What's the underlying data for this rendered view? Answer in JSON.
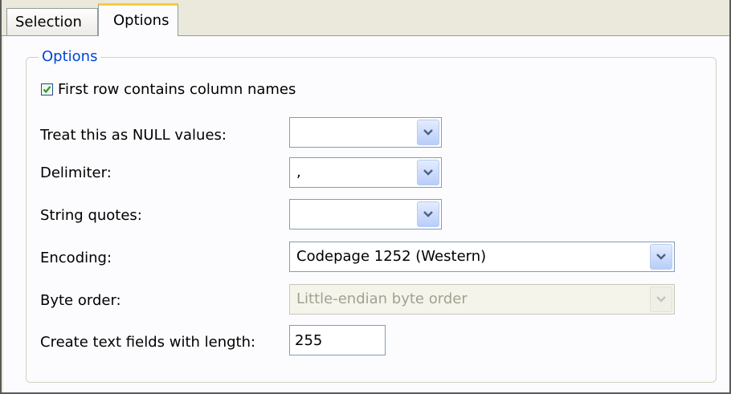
{
  "tabs": [
    {
      "label": "Selection"
    },
    {
      "label": "Options"
    }
  ],
  "group": {
    "title": "Options"
  },
  "first_row_checkbox": {
    "label": "First row contains column names",
    "checked": true
  },
  "fields": {
    "null_values": {
      "label": "Treat this as NULL values:",
      "value": ""
    },
    "delimiter": {
      "label": "Delimiter:",
      "value": ","
    },
    "string_quotes": {
      "label": "String quotes:",
      "value": ""
    },
    "encoding": {
      "label": "Encoding:",
      "value": "Codepage 1252 (Western)"
    },
    "byte_order": {
      "label": "Byte order:",
      "value": "Little-endian byte order",
      "disabled": true
    },
    "text_length": {
      "label": "Create text fields with length:",
      "value": "255"
    }
  },
  "icons": {
    "dropdown": "chevron-down-icon",
    "check": "checkmark-icon"
  },
  "colors": {
    "group_title": "#0046d5",
    "active_tab_accent": "#ffc83c",
    "checkmark": "#21a121"
  }
}
